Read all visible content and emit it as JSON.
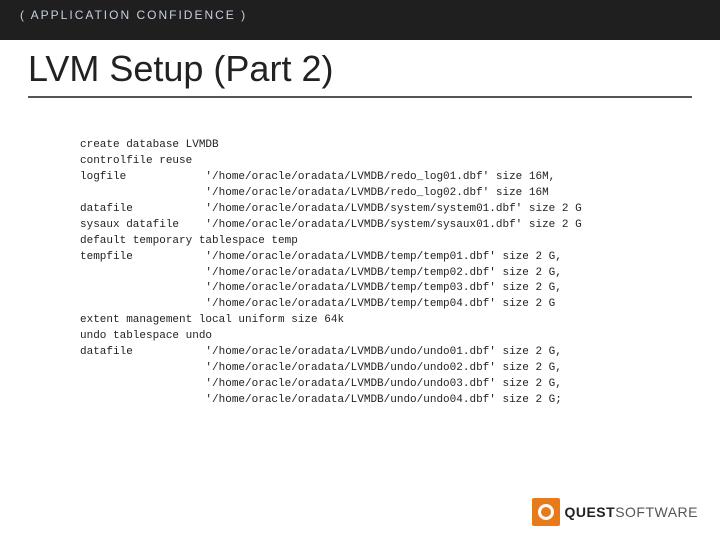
{
  "header": {
    "tag": "( APPLICATION CONFIDENCE )"
  },
  "title": "LVM Setup (Part 2)",
  "code": {
    "lines": [
      "create database LVMDB",
      "controlfile reuse",
      "logfile            '/home/oracle/oradata/LVMDB/redo_log01.dbf' size 16M,",
      "                   '/home/oracle/oradata/LVMDB/redo_log02.dbf' size 16M",
      "datafile           '/home/oracle/oradata/LVMDB/system/system01.dbf' size 2 G",
      "sysaux datafile    '/home/oracle/oradata/LVMDB/system/sysaux01.dbf' size 2 G",
      "default temporary tablespace temp",
      "tempfile           '/home/oracle/oradata/LVMDB/temp/temp01.dbf' size 2 G,",
      "                   '/home/oracle/oradata/LVMDB/temp/temp02.dbf' size 2 G,",
      "                   '/home/oracle/oradata/LVMDB/temp/temp03.dbf' size 2 G,",
      "                   '/home/oracle/oradata/LVMDB/temp/temp04.dbf' size 2 G",
      "extent management local uniform size 64k",
      "undo tablespace undo",
      "datafile           '/home/oracle/oradata/LVMDB/undo/undo01.dbf' size 2 G,",
      "                   '/home/oracle/oradata/LVMDB/undo/undo02.dbf' size 2 G,",
      "                   '/home/oracle/oradata/LVMDB/undo/undo03.dbf' size 2 G,",
      "                   '/home/oracle/oradata/LVMDB/undo/undo04.dbf' size 2 G;"
    ]
  },
  "logo": {
    "brand_bold": "QUEST",
    "brand_light": "SOFTWARE"
  }
}
